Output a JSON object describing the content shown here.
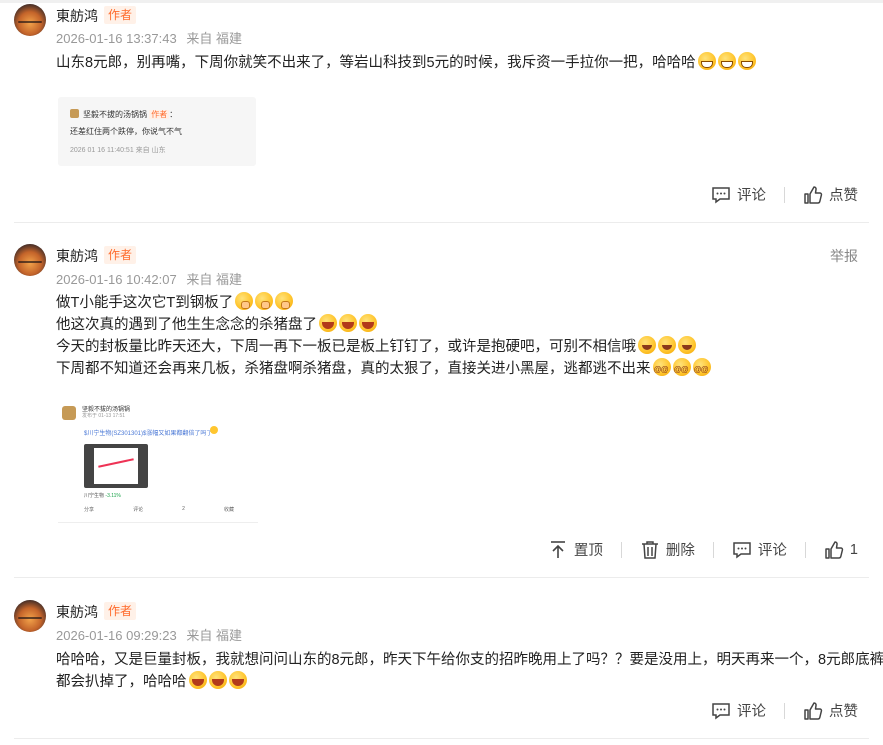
{
  "comments": [
    {
      "author": "東舫鸿",
      "badge": "作者",
      "time": "2026-01-16 13:37:43",
      "location": "来自 福建",
      "lines": [
        "山东8元郎，别再嘴，下周你就笑不出来了，等岩山科技到5元的时候，我斥资一手拉你一把，哈哈哈"
      ],
      "emojis": [
        "grin-emoji",
        "grin-emoji",
        "grin-emoji"
      ],
      "quote": {
        "user": "坚毅不拔的汤锅锅",
        "badge": "作者",
        "text": "还差红住两个跌停，你说气不气",
        "time": "2026 01 16 11:40:51",
        "location": "来自 山东"
      },
      "actions": {
        "comment": "评论",
        "like": "点赞"
      }
    },
    {
      "author": "東舫鸿",
      "badge": "作者",
      "time": "2026-01-16 10:42:07",
      "location": "来自 福建",
      "report": "举报",
      "lines": [
        "做T小能手这次它T到钢板了",
        "他这次真的遇到了他生生念念的杀猪盘了",
        "今天的封板量比昨天还大，下周一再下一板已是板上钉钉了，或许是抱硬吧，可别不相信哦",
        "下周都不知道还会再来几板，杀猪盘啊杀猪盘，真的太狠了，直接关进小黑屋，逃都逃不出来"
      ],
      "screenshot": {
        "user": "坚毅不拔的汤锅锅",
        "date": "发布于 01-13 17:51",
        "link": "$川宁生物(SZ301301)$涨幅又如果都翻倍了吗了",
        "stock": "川宁生物",
        "stock_change": "-3.11%",
        "acts": [
          "分享",
          "评论",
          "2",
          "收藏"
        ]
      },
      "actions": {
        "pin": "置顶",
        "delete": "删除",
        "comment": "评论",
        "like_count": "1"
      }
    },
    {
      "author": "東舫鸿",
      "badge": "作者",
      "time": "2026-01-16 09:29:23",
      "location": "来自 福建",
      "lines": [
        "哈哈哈，又是巨量封板，我就想问问山东的8元郎，昨天下午给你支的招昨晚用上了吗？？要是没用上，明天再来一个，8元郎底裤",
        "都会扒掉了，哈哈哈"
      ],
      "actions": {
        "comment": "评论",
        "like": "点赞"
      }
    }
  ]
}
